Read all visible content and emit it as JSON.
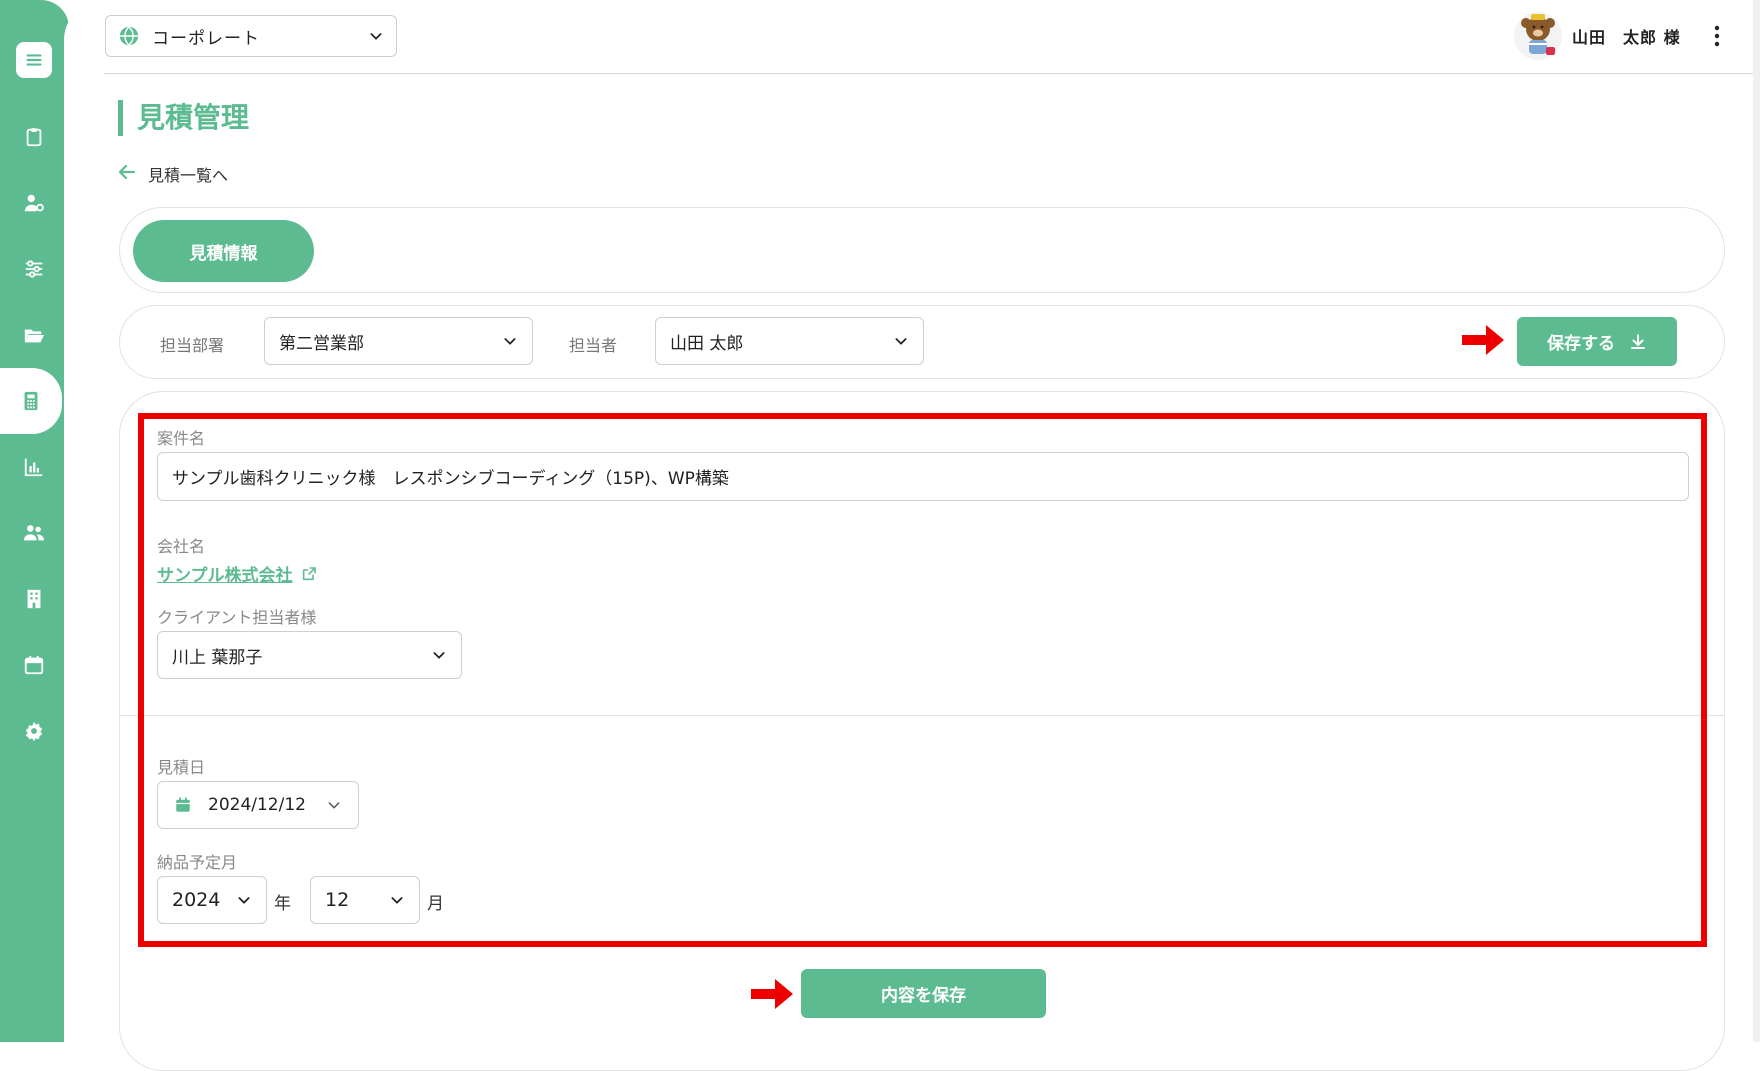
{
  "header": {
    "site_selector": {
      "value": "コーポレート"
    },
    "user": {
      "name": "山田　太郎 様"
    }
  },
  "page": {
    "title": "見積管理",
    "back_link": "見積一覧へ"
  },
  "tabs": [
    {
      "label": "見積情報",
      "active": true
    }
  ],
  "assignment": {
    "department_label": "担当部署",
    "department_value": "第二営業部",
    "person_label": "担当者",
    "person_value": "山田 太郎",
    "save_label": "保存する"
  },
  "form": {
    "project_label": "案件名",
    "project_value": "サンプル歯科クリニック様　レスポンシブコーディング（15P)、WP構築",
    "company_label": "会社名",
    "company_link": "サンプル株式会社",
    "client_contact_label": "クライアント担当者様",
    "client_contact_value": "川上 葉那子",
    "estimate_date_label": "見積日",
    "estimate_date_value": "2024/12/12",
    "delivery_month_label": "納品予定月",
    "delivery_year_value": "2024",
    "year_unit": "年",
    "delivery_month_value": "12",
    "month_unit": "月"
  },
  "footer": {
    "save_content_label": "内容を保存"
  },
  "sidebar": {
    "items": [
      {
        "icon": "menu-icon"
      },
      {
        "icon": "clipboard-icon"
      },
      {
        "icon": "user-gear-icon"
      },
      {
        "icon": "sliders-icon"
      },
      {
        "icon": "folder-open-icon"
      },
      {
        "icon": "calculator-icon",
        "active": true
      },
      {
        "icon": "bar-chart-icon"
      },
      {
        "icon": "users-icon"
      },
      {
        "icon": "building-icon"
      },
      {
        "icon": "calendar-icon"
      },
      {
        "icon": "gear-icon"
      }
    ]
  },
  "colors": {
    "accent": "#5dbb92",
    "highlight": "#ee0000"
  }
}
